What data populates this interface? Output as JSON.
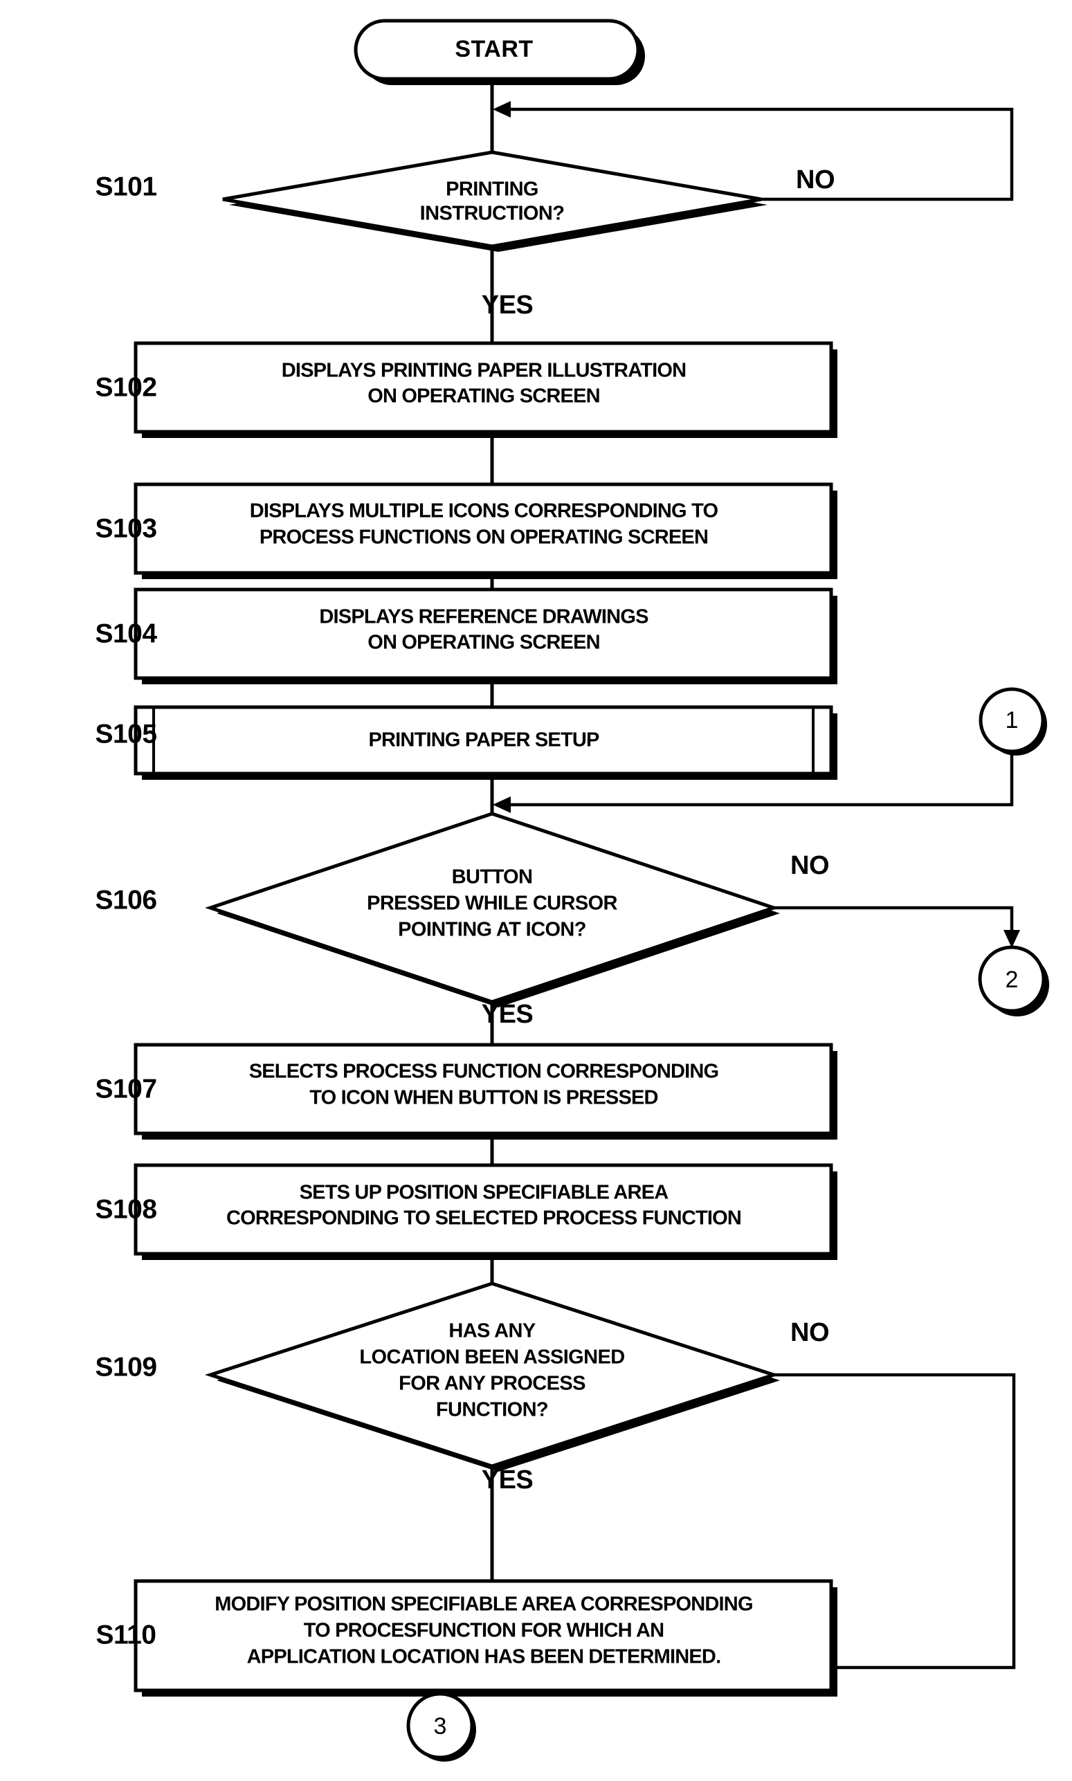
{
  "diagram": {
    "title_terminal": "START",
    "steps": [
      {
        "id": "S101",
        "label": "S101",
        "type": "decision",
        "text_lines": [
          "PRINTING",
          "INSTRUCTION?"
        ],
        "yes_label": "YES",
        "no_label": "NO"
      },
      {
        "id": "S102",
        "label": "S102",
        "type": "process",
        "text_lines": [
          "DISPLAYS PRINTING PAPER ILLUSTRATION",
          "ON OPERATING SCREEN"
        ]
      },
      {
        "id": "S103",
        "label": "S103",
        "type": "process",
        "text_lines": [
          "DISPLAYS MULTIPLE ICONS CORRESPONDING TO",
          "PROCESS FUNCTIONS ON OPERATING SCREEN"
        ]
      },
      {
        "id": "S104",
        "label": "S104",
        "type": "process",
        "text_lines": [
          "DISPLAYS REFERENCE DRAWINGS",
          "ON OPERATING SCREEN"
        ]
      },
      {
        "id": "S105",
        "label": "S105",
        "type": "predefined-process",
        "text_lines": [
          "PRINTING PAPER SETUP"
        ]
      },
      {
        "id": "S106",
        "label": "S106",
        "type": "decision",
        "text_lines": [
          "BUTTON",
          "PRESSED WHILE CURSOR",
          "POINTING AT ICON?"
        ],
        "yes_label": "YES",
        "no_label": "NO"
      },
      {
        "id": "S107",
        "label": "S107",
        "type": "process",
        "text_lines": [
          "SELECTS PROCESS FUNCTION CORRESPONDING",
          "TO ICON WHEN BUTTON IS PRESSED"
        ]
      },
      {
        "id": "S108",
        "label": "S108",
        "type": "process",
        "text_lines": [
          "SETS UP POSITION SPECIFIABLE AREA",
          "CORRESPONDING TO SELECTED PROCESS FUNCTION"
        ]
      },
      {
        "id": "S109",
        "label": "S109",
        "type": "decision",
        "text_lines": [
          "HAS ANY",
          "LOCATION BEEN ASSIGNED",
          "FOR ANY PROCESS",
          "FUNCTION?"
        ],
        "yes_label": "YES",
        "no_label": "NO"
      },
      {
        "id": "S110",
        "label": "S110",
        "type": "process",
        "text_lines": [
          "MODIFY POSITION SPECIFIABLE AREA CORRESPONDING",
          "TO PROCESFUNCTION FOR WHICH AN",
          "APPLICATION LOCATION HAS BEEN DETERMINED."
        ]
      }
    ],
    "connectors": [
      {
        "id": "conn-1",
        "text": "1"
      },
      {
        "id": "conn-2",
        "text": "2"
      },
      {
        "id": "conn-3",
        "text": "3"
      }
    ],
    "colors": {
      "stroke": "#000000",
      "fill": "#ffffff",
      "text": "#000000"
    }
  }
}
